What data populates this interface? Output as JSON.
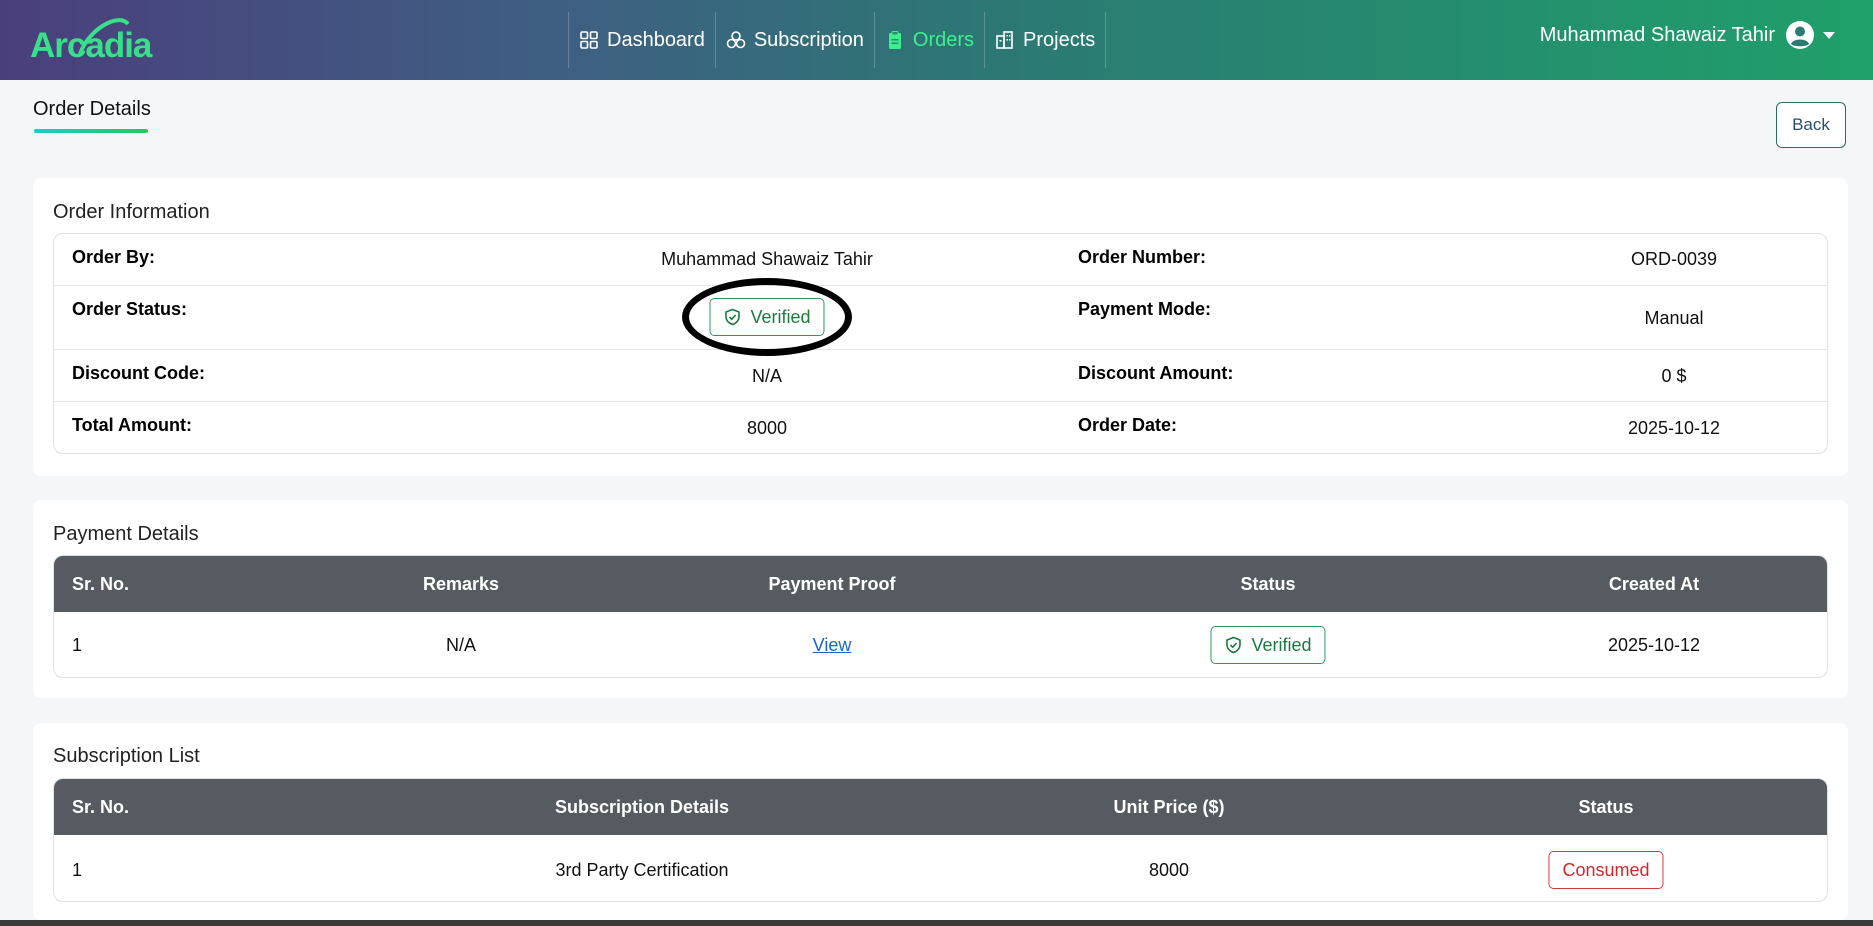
{
  "app": {
    "logo_text": "Arcadia"
  },
  "nav": {
    "items": [
      {
        "label": "Dashboard",
        "icon": "grid-icon",
        "active": false
      },
      {
        "label": "Subscription",
        "icon": "circles-icon",
        "active": false
      },
      {
        "label": "Orders",
        "icon": "clipboard-icon",
        "active": true
      },
      {
        "label": "Projects",
        "icon": "building-icon",
        "active": false
      }
    ]
  },
  "user": {
    "name": "Muhammad Shawaiz Tahir",
    "icon": "user-circle-icon"
  },
  "page": {
    "title": "Order Details",
    "back_label": "Back"
  },
  "order_info": {
    "title": "Order Information",
    "order_by_label": "Order By:",
    "order_by": "Muhammad Shawaiz Tahir",
    "order_number_label": "Order Number:",
    "order_number": "ORD-0039",
    "order_status_label": "Order Status:",
    "order_status": "Verified",
    "payment_mode_label": "Payment Mode:",
    "payment_mode": "Manual",
    "discount_code_label": "Discount Code:",
    "discount_code": "N/A",
    "discount_amount_label": "Discount Amount:",
    "discount_amount": "0 $",
    "total_amount_label": "Total Amount:",
    "total_amount": "8000",
    "order_date_label": "Order Date:",
    "order_date": "2025-10-12"
  },
  "payment_details": {
    "title": "Payment Details",
    "headers": [
      "Sr. No.",
      "Remarks",
      "Payment Proof",
      "Status",
      "Created At"
    ],
    "rows": [
      {
        "sr": "1",
        "remarks": "N/A",
        "proof": "View",
        "status": "Verified",
        "created_at": "2025-10-12"
      }
    ]
  },
  "subscription_list": {
    "title": "Subscription List",
    "headers": [
      "Sr. No.",
      "Subscription Details",
      "Unit Price ($)",
      "Status"
    ],
    "rows": [
      {
        "sr": "1",
        "details": "3rd Party Certification",
        "unit_price": "8000",
        "status": "Consumed"
      }
    ]
  },
  "colors": {
    "accent_green": "#3df08f",
    "table_header": "#555b60",
    "verified": "#1d7a3f",
    "consumed": "#cc2a2a"
  }
}
